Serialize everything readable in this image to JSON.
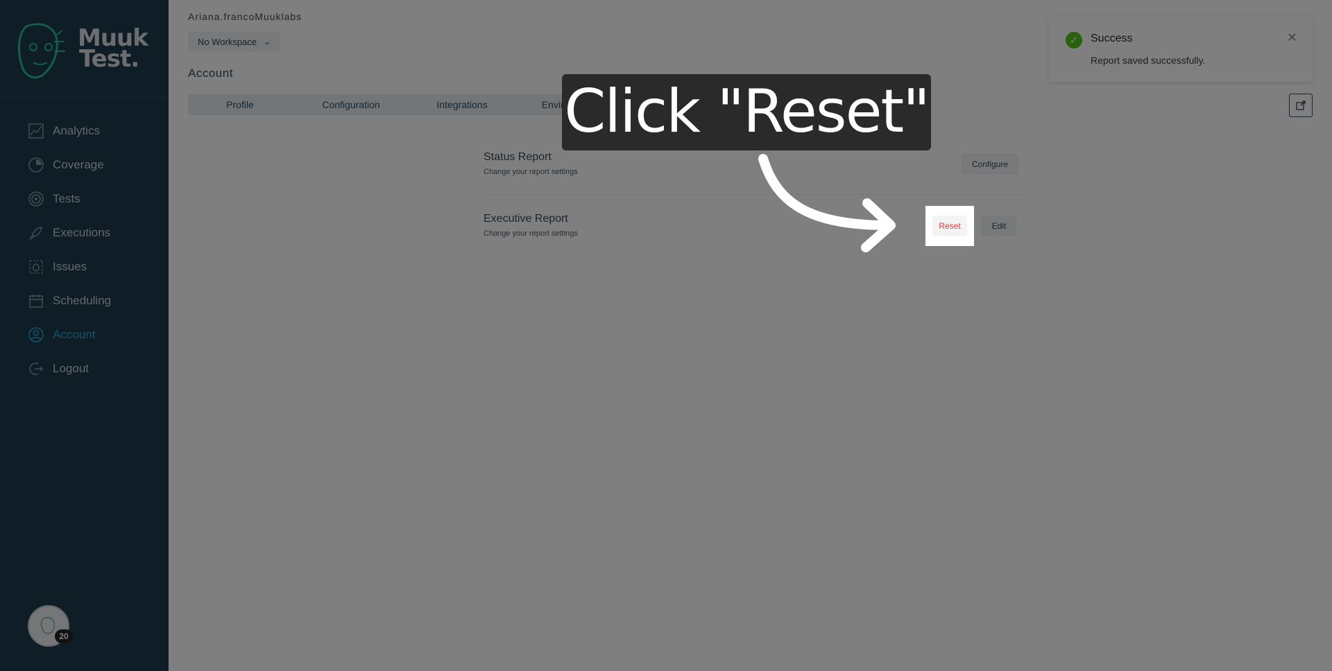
{
  "app": {
    "logo_text_line1": "Muuk",
    "logo_text_line2": "Test."
  },
  "sidebar": {
    "items": [
      {
        "label": "Analytics",
        "icon": "chart-line-icon"
      },
      {
        "label": "Coverage",
        "icon": "pie-chart-icon"
      },
      {
        "label": "Tests",
        "icon": "target-icon"
      },
      {
        "label": "Executions",
        "icon": "rocket-icon"
      },
      {
        "label": "Issues",
        "icon": "bug-icon"
      },
      {
        "label": "Scheduling",
        "icon": "calendar-icon"
      },
      {
        "label": "Account",
        "icon": "user-icon",
        "active": true
      },
      {
        "label": "Logout",
        "icon": "logout-icon"
      }
    ],
    "avatar_badge": "20"
  },
  "header": {
    "username": "Ariana.francoMuuklabs",
    "workspace_label": "No Workspace",
    "page_title": "Account"
  },
  "tabs": [
    {
      "label": "Profile"
    },
    {
      "label": "Configuration"
    },
    {
      "label": "Integrations"
    },
    {
      "label": "Environments"
    },
    {
      "label": ""
    }
  ],
  "reports": [
    {
      "title": "Status Report",
      "subtitle": "Change your report settings",
      "button": "Configure"
    },
    {
      "title": "Executive Report",
      "subtitle": "Change your report settings",
      "button_reset": "Reset",
      "button_edit": "Edit"
    }
  ],
  "toast": {
    "title": "Success",
    "message": "Report saved successfully.",
    "close_icon": "close-icon",
    "status_icon": "check-circle-icon"
  },
  "tutorial": {
    "callout_text": "Click \"Reset\"",
    "arrow_icon": "curved-arrow-icon"
  },
  "colors": {
    "sidebar_bg": "#1d3a4c",
    "accent": "#2ba6d6",
    "danger": "#d03a3a",
    "success": "#52c41a"
  }
}
